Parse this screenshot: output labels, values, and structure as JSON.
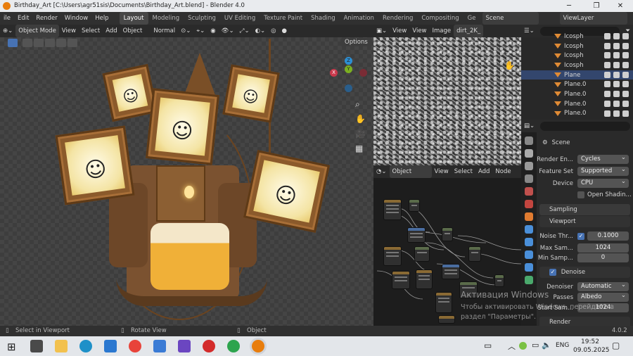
{
  "window": {
    "title": "Birthday_Art [C:\\Users\\agr51sis\\Documents\\Birthday_Art.blend] - Blender 4.0",
    "controls": [
      "─",
      "❐",
      "✕"
    ]
  },
  "menu": {
    "items": [
      "ile",
      "Edit",
      "Render",
      "Window",
      "Help"
    ]
  },
  "workspaces": [
    "Layout",
    "Modeling",
    "Sculpting",
    "UV Editing",
    "Texture Paint",
    "Shading",
    "Animation",
    "Rendering",
    "Compositing",
    "Ge"
  ],
  "scene_selector": "Scene",
  "view_layer": "ViewLayer",
  "viewport": {
    "mode": "Object Mode",
    "menus": [
      "View",
      "Select",
      "Add",
      "Object"
    ],
    "orientation": "Normal",
    "options": "Options",
    "gizmo": {
      "x": "X",
      "y": "Y",
      "z": "Z"
    },
    "faces": [
      "☺",
      "☺",
      "☺",
      "☺",
      "☺"
    ]
  },
  "image_editor": {
    "menus": [
      "View",
      "View",
      "Image"
    ],
    "image_name": "dirt_2K_"
  },
  "outliner": {
    "rows": [
      {
        "name": "Icosph",
        "selected": false
      },
      {
        "name": "Icosph",
        "selected": false
      },
      {
        "name": "Icosph",
        "selected": false
      },
      {
        "name": "Icosph",
        "selected": false
      },
      {
        "name": "Plane",
        "selected": true
      },
      {
        "name": "Plane.0",
        "selected": false
      },
      {
        "name": "Plane.0",
        "selected": false
      },
      {
        "name": "Plane.0",
        "selected": false
      },
      {
        "name": "Plane.0",
        "selected": false
      }
    ]
  },
  "properties": {
    "scene": "Scene",
    "render_engine_label": "Render En...",
    "render_engine": "Cycles",
    "feature_set_label": "Feature Set",
    "feature_set": "Supported",
    "device_label": "Device",
    "device": "CPU",
    "open_shading": "Open Shadin...",
    "sampling": "Sampling",
    "viewport": "Viewport",
    "noise_label": "Noise Thr...",
    "noise_value": "0.1000",
    "max_samples_label": "Max Sam...",
    "max_samples": "1024",
    "min_samples_label": "Min Samp...",
    "min_samples": "0",
    "denoise": "Denoise",
    "denoiser_label": "Denoiser",
    "denoiser": "Automatic",
    "passes_label": "Passes",
    "passes": "Albedo",
    "start_sample_label": "Start Sam...",
    "start_sample": "1024",
    "render": "Render",
    "version": "4.0.2"
  },
  "node_editor": {
    "mode": "Object",
    "menus": [
      "View",
      "Select",
      "Add",
      "Node"
    ]
  },
  "status": {
    "select": "Select in Viewport",
    "rotate": "Rotate View",
    "object": "Object"
  },
  "activation": {
    "title": "Активация Windows",
    "line1": "Чтобы активировать Windows, перейдите в",
    "line2": "раздел \"Параметры\"."
  },
  "taskbar": {
    "time": "19:52",
    "date": "09.05.2025",
    "lang": "ENG"
  }
}
